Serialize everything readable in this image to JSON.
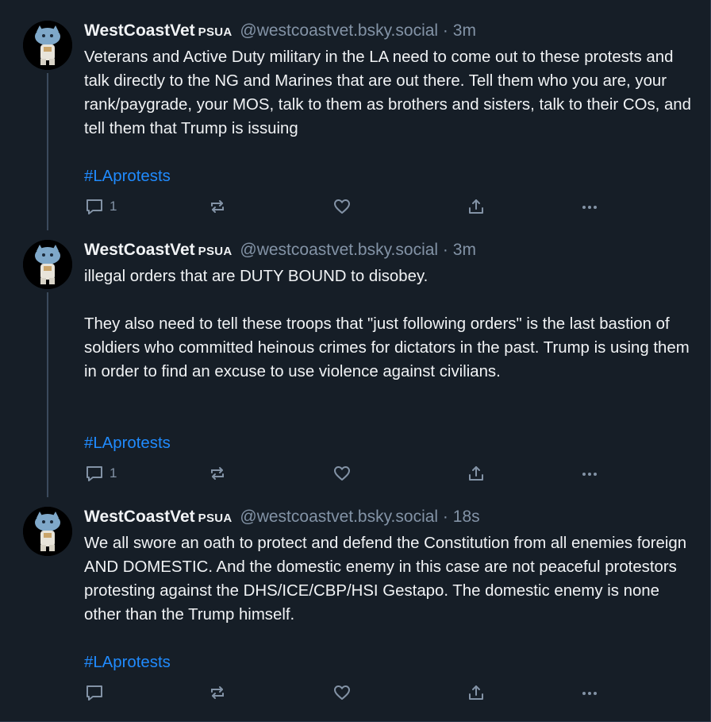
{
  "posts": [
    {
      "author_name": "WestCoastVet",
      "badge": "PSUA",
      "handle": "@westcoastvet.bsky.social",
      "separator": "·",
      "time": "3m",
      "paragraphs": [
        "Veterans and Active Duty military in the LA need to come out to these protests and talk directly to the NG and Marines that are out there. Tell them who you are, your rank/paygrade, your MOS, talk to them as brothers and sisters, talk to their COs, and tell them that Trump is issuing"
      ],
      "hashtag": "#LAprotests",
      "reply_count": "1"
    },
    {
      "author_name": "WestCoastVet",
      "badge": "PSUA",
      "handle": "@westcoastvet.bsky.social",
      "separator": "·",
      "time": "3m",
      "paragraphs": [
        "illegal orders that are DUTY BOUND to disobey.",
        "They also need to tell these troops that \"just following orders\" is the last bastion of soldiers who committed heinous crimes for dictators in the past. Trump is using them in order to find an excuse to use violence against civilians."
      ],
      "hashtag": "#LAprotests",
      "reply_count": "1"
    },
    {
      "author_name": "WestCoastVet",
      "badge": "PSUA",
      "handle": "@westcoastvet.bsky.social",
      "separator": "·",
      "time": "18s",
      "paragraphs": [
        "We all swore an oath to protect and defend the Constitution from all enemies foreign AND DOMESTIC. And the domestic enemy in this case are not peaceful protestors protesting against the DHS/ICE/CBP/HSI Gestapo. The domestic enemy is none other than the Trump himself."
      ],
      "hashtag": "#LAprotests",
      "reply_count": ""
    }
  ],
  "icons": {
    "reply": "reply-bubble-icon",
    "repost": "repost-arrows-icon",
    "like": "heart-icon",
    "share": "share-upload-icon",
    "more": "more-dots-icon"
  },
  "colors": {
    "background": "#161e27",
    "text": "#f1f3f5",
    "muted": "#8393a6",
    "link": "#208bfe",
    "thread_line": "#3b4a5c"
  }
}
